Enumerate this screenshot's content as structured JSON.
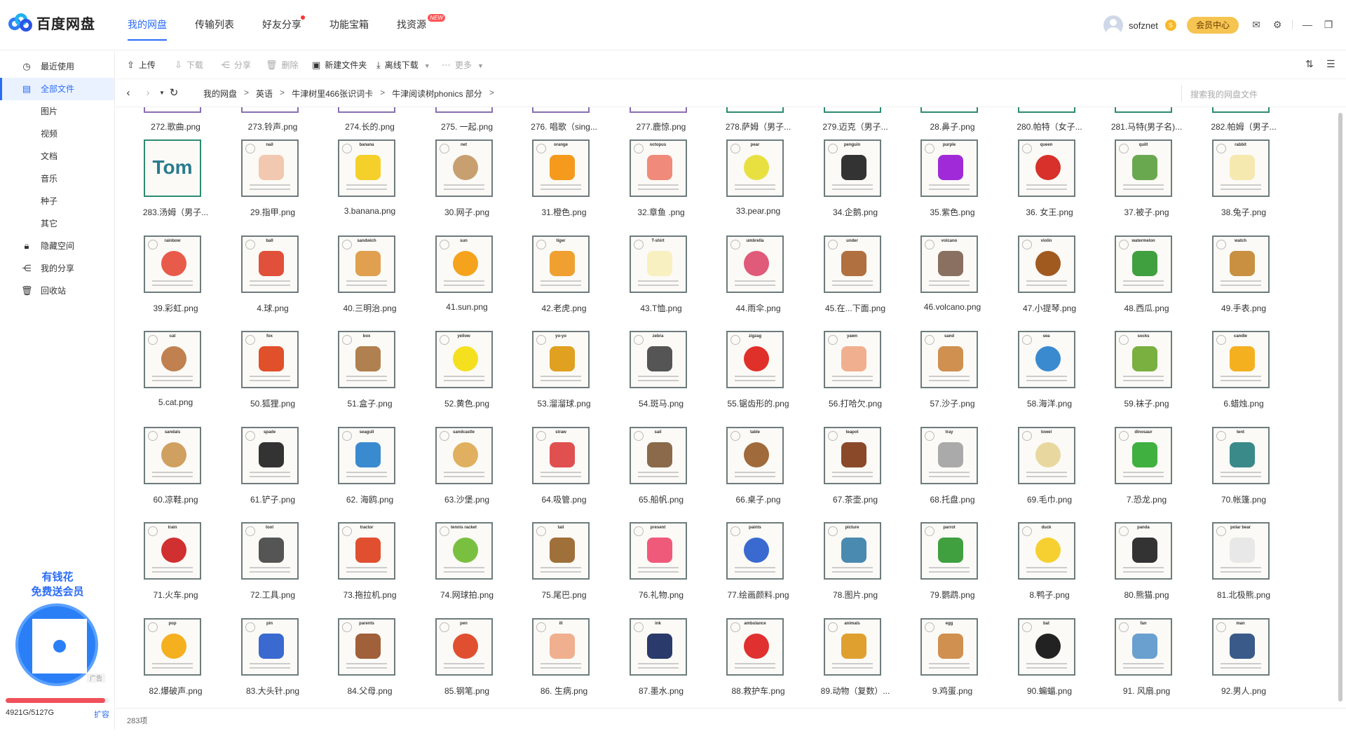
{
  "app": {
    "name": "百度网盘"
  },
  "nav": {
    "tabs": [
      "我的网盘",
      "传输列表",
      "好友分享",
      "功能宝箱",
      "找资源"
    ],
    "new_badge": "NEW"
  },
  "user": {
    "name": "sofznet",
    "vip_label": "会员中心"
  },
  "sidebar": {
    "items": [
      "最近使用",
      "全部文件",
      "图片",
      "视频",
      "文档",
      "音乐",
      "种子",
      "其它",
      "隐藏空间",
      "我的分享",
      "回收站"
    ],
    "promo_line1": "有钱花",
    "promo_line2": "免费送会员",
    "ad_tag": "广告",
    "storage_text": "4921G/5127G",
    "storage_used_fraction": 0.96,
    "expand_label": "扩容"
  },
  "toolbar": {
    "upload": "上传",
    "download": "下载",
    "share": "分享",
    "delete": "删除",
    "new_folder": "新建文件夹",
    "offline": "离线下载",
    "more": "更多"
  },
  "path": {
    "crumbs": [
      "我的网盘",
      "英语",
      "牛津树里466张识词卡",
      "牛津阅读树phonics 部分"
    ],
    "search_placeholder": "搜索我的网盘文件"
  },
  "status": {
    "count": "283项"
  },
  "files_top": [
    "272.歌曲.png",
    "273.铃声.png",
    "274.长的.png",
    "275. 一起.png",
    "276. 唱歌（sing...",
    "277.鹿惊.png",
    "278.萨姆（男子...",
    "279.迈克（男子...",
    "28.鼻子.png",
    "280.帕特（女子...",
    "281.马特(男子名)...",
    "282.帕姆（男子..."
  ],
  "files": [
    {
      "name": "283.汤姆（男子...",
      "word": "Tom",
      "color": "#2a7a8f"
    },
    {
      "name": "29.指甲.png",
      "word": "nail",
      "color": "#f2c8b0"
    },
    {
      "name": "3.banana.png",
      "word": "banana",
      "color": "#f5d02a"
    },
    {
      "name": "30.网子.png",
      "word": "net",
      "color": "#c8a070"
    },
    {
      "name": "31.橙色.png",
      "word": "orange",
      "color": "#f59a1c"
    },
    {
      "name": "32.章鱼 .png",
      "word": "octopus",
      "color": "#f08a7a"
    },
    {
      "name": "33.pear.png",
      "word": "pear",
      "color": "#e8e040"
    },
    {
      "name": "34.企鹅.png",
      "word": "penguin",
      "color": "#333333"
    },
    {
      "name": "35.紫色.png",
      "word": "purple",
      "color": "#a02ad8"
    },
    {
      "name": "36. 女王.png",
      "word": "queen",
      "color": "#d8302a"
    },
    {
      "name": "37.被子.png",
      "word": "quilt",
      "color": "#6aa84f"
    },
    {
      "name": "38.兔子.png",
      "word": "rabbit",
      "color": "#f5e9b0"
    },
    {
      "name": "39.彩虹.png",
      "word": "rainbow",
      "color": "#e85a4a"
    },
    {
      "name": "4.球.png",
      "word": "ball",
      "color": "#e0503a"
    },
    {
      "name": "40.三明治.png",
      "word": "sandwich",
      "color": "#e0a050"
    },
    {
      "name": "41.sun.png",
      "word": "sun",
      "color": "#f5a31c"
    },
    {
      "name": "42.老虎.png",
      "word": "tiger",
      "color": "#f0a030"
    },
    {
      "name": "43.T恤.png",
      "word": "T-shirt",
      "color": "#f8f0c0"
    },
    {
      "name": "44.雨伞.png",
      "word": "umbrella",
      "color": "#e05a7a"
    },
    {
      "name": "45.在...下面.png",
      "word": "under",
      "color": "#b07040"
    },
    {
      "name": "46.volcano.png",
      "word": "volcano",
      "color": "#8a7060"
    },
    {
      "name": "47.小提琴.png",
      "word": "violin",
      "color": "#a05a20"
    },
    {
      "name": "48.西瓜.png",
      "word": "watermelon",
      "color": "#40a040"
    },
    {
      "name": "49.手表.png",
      "word": "watch",
      "color": "#c89040"
    },
    {
      "name": "5.cat.png",
      "word": "cat",
      "color": "#c08050"
    },
    {
      "name": "50.狐狸.png",
      "word": "fox",
      "color": "#e0502a"
    },
    {
      "name": "51.盒子.png",
      "word": "box",
      "color": "#b08050"
    },
    {
      "name": "52.黄色.png",
      "word": "yellow",
      "color": "#f5e020"
    },
    {
      "name": "53.溜溜球.png",
      "word": "yo-yo",
      "color": "#e0a020"
    },
    {
      "name": "54.斑马.png",
      "word": "zebra",
      "color": "#555555"
    },
    {
      "name": "55.锯齿形的.png",
      "word": "zigzag",
      "color": "#e0302a"
    },
    {
      "name": "56.打哈欠.png",
      "word": "yawn",
      "color": "#f0b090"
    },
    {
      "name": "57.沙子.png",
      "word": "sand",
      "color": "#d09050"
    },
    {
      "name": "58.海洋.png",
      "word": "sea",
      "color": "#3a8ad0"
    },
    {
      "name": "59.袜子.png",
      "word": "socks",
      "color": "#7ab040"
    },
    {
      "name": "6.蜡烛.png",
      "word": "candle",
      "color": "#f5b020"
    },
    {
      "name": "60.凉鞋.png",
      "word": "sandals",
      "color": "#d0a060"
    },
    {
      "name": "61.铲子.png",
      "word": "spade",
      "color": "#333333"
    },
    {
      "name": "62. 海鸥.png",
      "word": "seagull",
      "color": "#3a8ad0"
    },
    {
      "name": "63.沙堡.png",
      "word": "sandcastle",
      "color": "#e0b060"
    },
    {
      "name": "64.吸管.png",
      "word": "straw",
      "color": "#e05050"
    },
    {
      "name": "65.船帆.png",
      "word": "sail",
      "color": "#8a6a4a"
    },
    {
      "name": "66.桌子.png",
      "word": "table",
      "color": "#a06a3a"
    },
    {
      "name": "67.茶壶.png",
      "word": "teapot",
      "color": "#8a4a2a"
    },
    {
      "name": "68.托盘.png",
      "word": "tray",
      "color": "#aaaaaa"
    },
    {
      "name": "69.毛巾.png",
      "word": "towel",
      "color": "#e8d8a0"
    },
    {
      "name": "7.恐龙.png",
      "word": "dinosaur",
      "color": "#40b040"
    },
    {
      "name": "70.帐篷.png",
      "word": "tent",
      "color": "#3a8a8a"
    },
    {
      "name": "71.火车.png",
      "word": "train",
      "color": "#d03030"
    },
    {
      "name": "72.工具.png",
      "word": "tool",
      "color": "#555555"
    },
    {
      "name": "73.拖拉机.png",
      "word": "tractor",
      "color": "#e05030"
    },
    {
      "name": "74.网球拍.png",
      "word": "tennis racket",
      "color": "#7ac040"
    },
    {
      "name": "75.尾巴.png",
      "word": "tail",
      "color": "#a0703a"
    },
    {
      "name": "76.礼物.png",
      "word": "present",
      "color": "#f05a7a"
    },
    {
      "name": "77.绘画颜料.png",
      "word": "paints",
      "color": "#3a6ad0"
    },
    {
      "name": "78.图片.png",
      "word": "picture",
      "color": "#4a8ab0"
    },
    {
      "name": "79.鹦鹉.png",
      "word": "parrot",
      "color": "#40a040"
    },
    {
      "name": "8.鸭子.png",
      "word": "duck",
      "color": "#f5d030"
    },
    {
      "name": "80.熊猫.png",
      "word": "panda",
      "color": "#333333"
    },
    {
      "name": "81.北极熊.png",
      "word": "polar bear",
      "color": "#e8e8e8"
    },
    {
      "name": "82.爆破声.png",
      "word": "pop",
      "color": "#f5b020"
    },
    {
      "name": "83.大头针.png",
      "word": "pin",
      "color": "#3a6ad0"
    },
    {
      "name": "84.父母.png",
      "word": "parents",
      "color": "#a0603a"
    },
    {
      "name": "85.钢笔.png",
      "word": "pen",
      "color": "#e05030"
    },
    {
      "name": "86. 生病.png",
      "word": "ill",
      "color": "#f0b090"
    },
    {
      "name": "87.墨水.png",
      "word": "ink",
      "color": "#2a3a6a"
    },
    {
      "name": "88.救护车.png",
      "word": "ambulance",
      "color": "#e03030"
    },
    {
      "name": "89.动物（复数）...",
      "word": "animals",
      "color": "#e0a030"
    },
    {
      "name": "9.鸡蛋.png",
      "word": "egg",
      "color": "#d09050"
    },
    {
      "name": "90.蝙蝠.png",
      "word": "bat",
      "color": "#222222"
    },
    {
      "name": "91. 风扇.png",
      "word": "fan",
      "color": "#6aa0d0"
    },
    {
      "name": "92.男人.png",
      "word": "man",
      "color": "#3a5a8a"
    }
  ]
}
